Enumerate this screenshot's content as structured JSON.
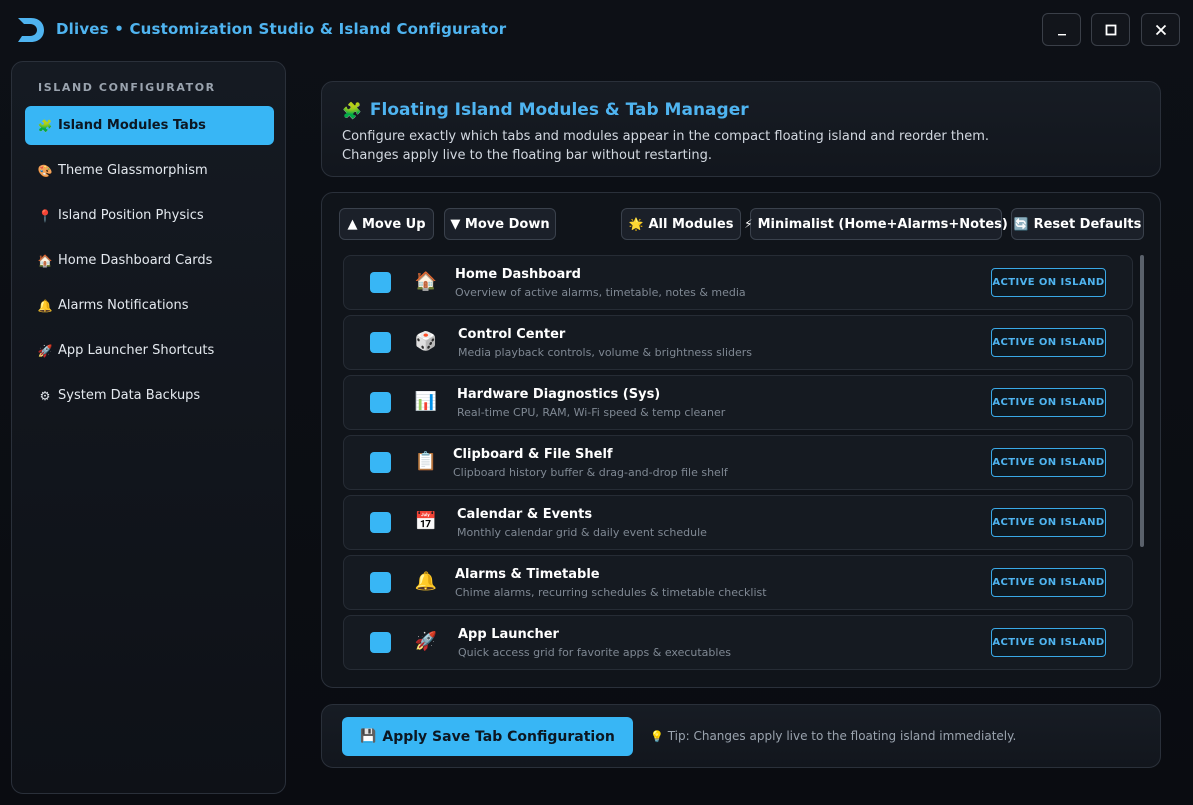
{
  "app": {
    "title": "Dlives • Customization Studio & Island Configurator",
    "window_controls": {
      "minimize": "_",
      "maximize": "☐",
      "close": "✕"
    }
  },
  "sidebar": {
    "heading": "ISLAND CONFIGURATOR",
    "items": [
      {
        "icon": "🧩",
        "label": "Island Modules  Tabs",
        "active": true
      },
      {
        "icon": "🎨",
        "label": "Theme  Glassmorphism",
        "active": false
      },
      {
        "icon": "📍",
        "label": "Island Position  Physics",
        "active": false
      },
      {
        "icon": "🏠",
        "label": "Home Dashboard Cards",
        "active": false
      },
      {
        "icon": "🔔",
        "label": "Alarms  Notifications",
        "active": false
      },
      {
        "icon": "🚀",
        "label": "App Launcher Shortcuts",
        "active": false
      },
      {
        "icon": "⚙",
        "label": "System  Data Backups",
        "active": false
      }
    ]
  },
  "header": {
    "icon": "🧩",
    "title": "Floating Island Modules & Tab Manager",
    "description_line1": "Configure exactly which tabs and modules appear in the compact floating island and reorder them.",
    "description_line2": "Changes apply live to the floating bar without restarting."
  },
  "toolbar": {
    "move_up": "▲ Move Up",
    "move_down": "▼ Move Down",
    "all_modules": "All Modules",
    "minimalist": "Minimalist (Home+Alarms+Notes)",
    "reset_defaults": "Reset Defaults"
  },
  "modules": [
    {
      "icon": "🏠",
      "title": "Home Dashboard",
      "subtitle": "Overview of active alarms, timetable, notes & media",
      "badge": "ACTIVE ON ISLAND"
    },
    {
      "icon": "🎲",
      "title": "Control Center",
      "subtitle": "Media playback controls, volume & brightness sliders",
      "badge": "ACTIVE ON ISLAND"
    },
    {
      "icon": "📊",
      "title": "Hardware Diagnostics (Sys)",
      "subtitle": "Real-time CPU, RAM, Wi-Fi speed & temp cleaner",
      "badge": "ACTIVE ON ISLAND"
    },
    {
      "icon": "📋",
      "title": "Clipboard & File Shelf",
      "subtitle": "Clipboard history buffer & drag-and-drop file shelf",
      "badge": "ACTIVE ON ISLAND"
    },
    {
      "icon": "📅",
      "title": "Calendar & Events",
      "subtitle": "Monthly calendar grid & daily event schedule",
      "badge": "ACTIVE ON ISLAND"
    },
    {
      "icon": "🔔",
      "title": "Alarms & Timetable",
      "subtitle": "Chime alarms, recurring schedules & timetable checklist",
      "badge": "ACTIVE ON ISLAND"
    },
    {
      "icon": "🚀",
      "title": "App Launcher",
      "subtitle": "Quick access grid for favorite apps & executables",
      "badge": "ACTIVE ON ISLAND"
    }
  ],
  "footer": {
    "apply_label": "Apply  Save Tab Configuration",
    "tip": "Tip: Changes apply live to the floating island immediately."
  },
  "colors": {
    "accent": "#38b6f5",
    "title_blue": "#4fb4f0",
    "background": "#0b0d12"
  }
}
